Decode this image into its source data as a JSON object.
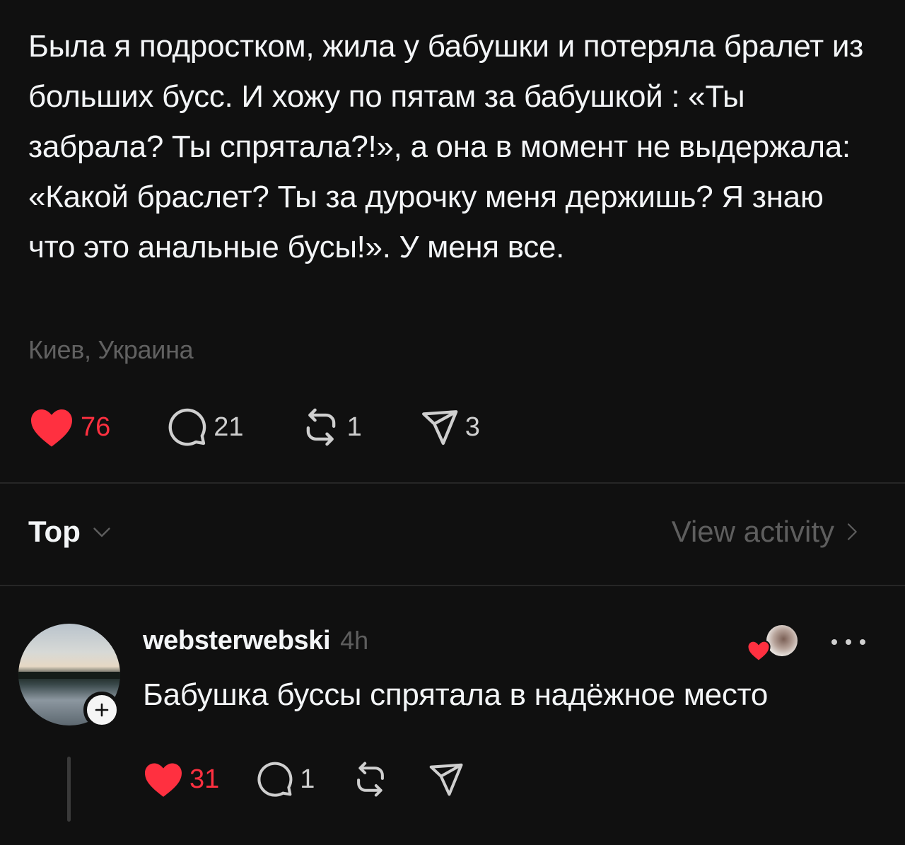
{
  "post": {
    "text": "Была я подростком, жила у бабушки и потеряла бралет из больших бусс. И хожу по пятам за бабушкой : «Ты забрала? Ты спрятала?!», а она в момент не выдержала: «Какой браслет? Ты за дурочку меня держишь? Я знаю что это анальные бусы!». У меня все.",
    "location": "Киев, Украина",
    "likes": "76",
    "comments": "21",
    "reposts": "1",
    "shares": "3"
  },
  "replies_header": {
    "sort_label": "Top",
    "view_activity_label": "View activity"
  },
  "reply": {
    "username": "websterwebski",
    "time": "4h",
    "text": "Бабушка буссы спрятала в надёжное место",
    "likes": "31",
    "comments": "1"
  },
  "colors": {
    "background": "#101010",
    "like_red": "#ff3040",
    "muted": "#5e5e5e"
  },
  "icons": [
    "heart-icon",
    "comment-icon",
    "repost-icon",
    "share-icon",
    "chevron-down-icon",
    "chevron-right-icon",
    "plus-icon",
    "more-icon"
  ]
}
